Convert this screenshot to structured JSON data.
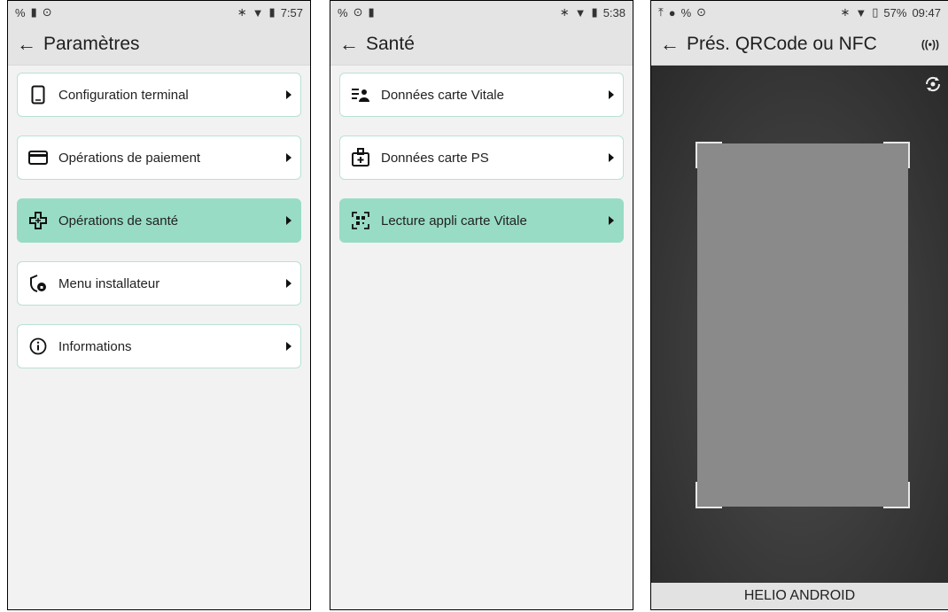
{
  "screen1": {
    "status": {
      "time": "7:57"
    },
    "title": "Paramètres",
    "items": [
      {
        "label": "Configuration terminal",
        "icon": "phone-icon"
      },
      {
        "label": "Opérations de paiement",
        "icon": "credit-card-icon"
      },
      {
        "label": "Opérations de santé",
        "icon": "medical-cross-icon",
        "active": true
      },
      {
        "label": "Menu installateur",
        "icon": "shield-lock-icon"
      },
      {
        "label": "Informations",
        "icon": "info-icon"
      }
    ]
  },
  "screen2": {
    "status": {
      "time": "5:38"
    },
    "title": "Santé",
    "items": [
      {
        "label": "Données carte Vitale",
        "icon": "person-list-icon"
      },
      {
        "label": "Données carte PS",
        "icon": "medical-badge-icon"
      },
      {
        "label": "Lecture appli carte Vitale",
        "icon": "qr-scan-icon",
        "active": true
      }
    ]
  },
  "screen3": {
    "status": {
      "time": "09:47",
      "battery": "57%"
    },
    "title": "Prés. QRCode ou NFC",
    "nfc": "((•))",
    "footer": "HELIO ANDROID"
  },
  "colors": {
    "accent": "#98dcc5",
    "border": "#b8e2d3"
  }
}
